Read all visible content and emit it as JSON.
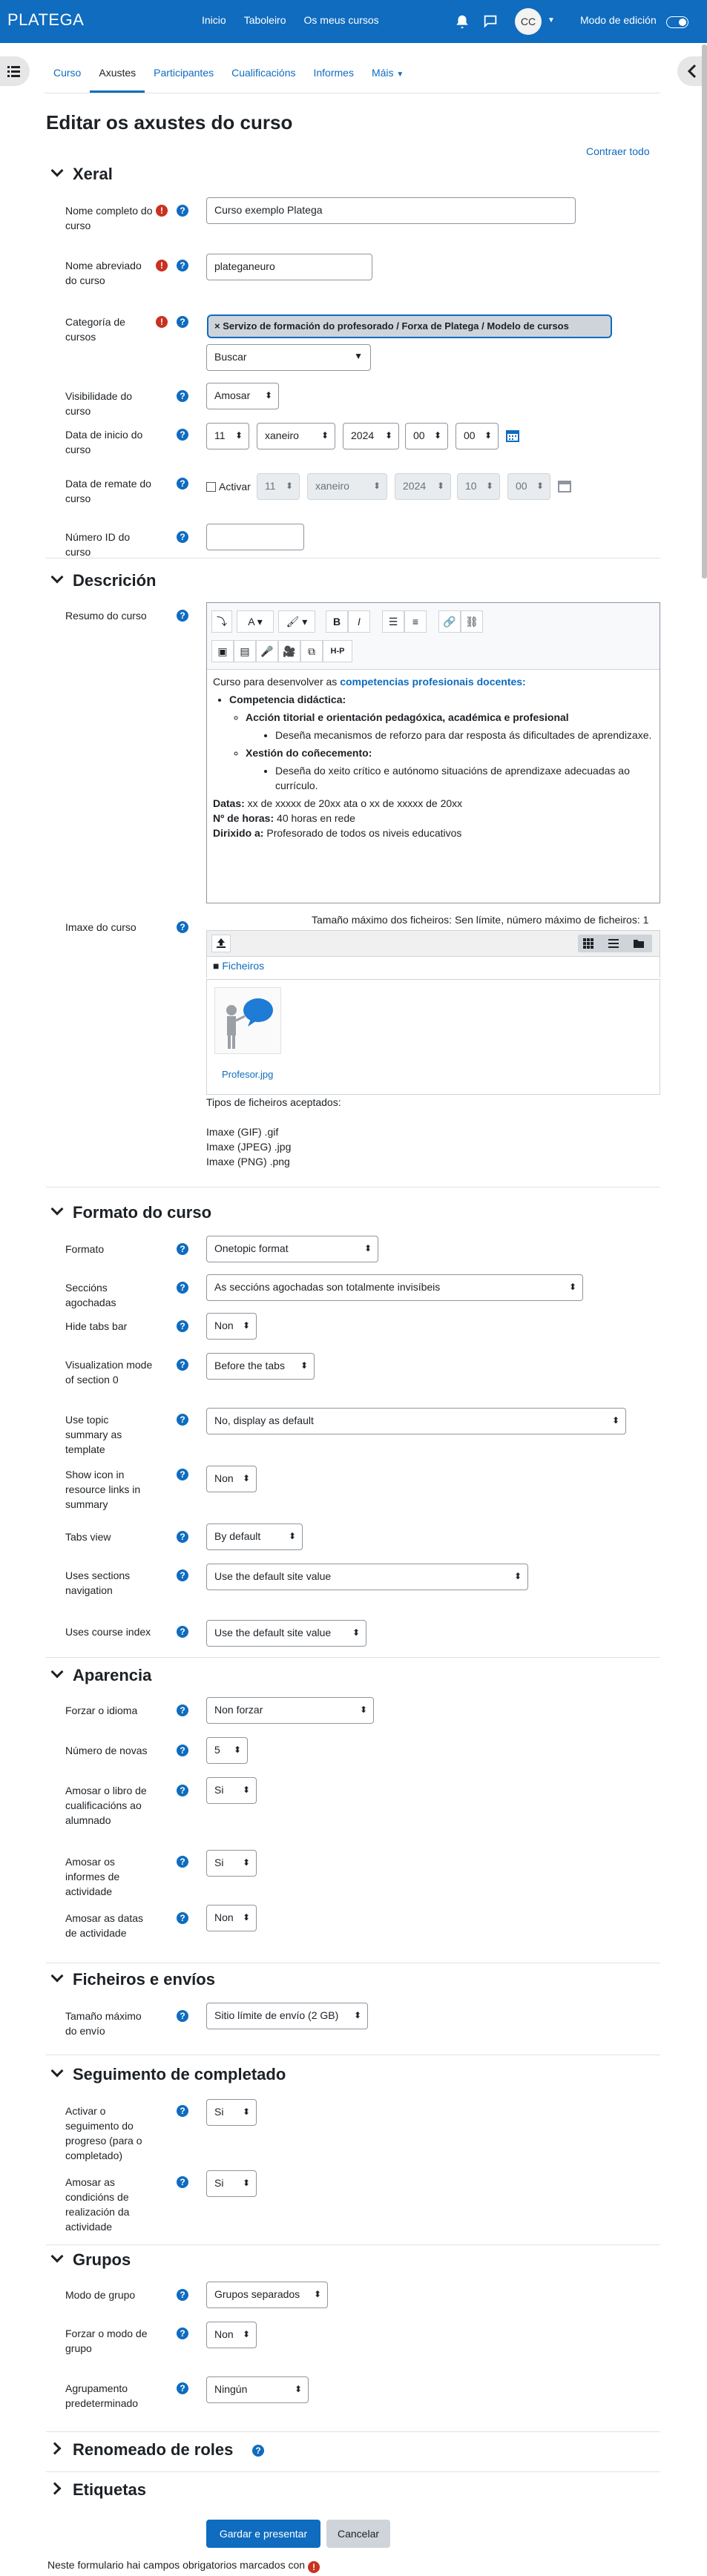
{
  "navbar": {
    "brand": "PLATEGA",
    "links": [
      "Inicio",
      "Taboleiro",
      "Os meus cursos"
    ],
    "avatar_initials": "CC",
    "edit_mode_label": "Modo de edición"
  },
  "secondary_nav": {
    "tabs": [
      "Curso",
      "Axustes",
      "Participantes",
      "Cualificacións",
      "Informes",
      "Máis"
    ],
    "active": "Axustes"
  },
  "page": {
    "title": "Editar os axustes do curso",
    "collapse_all": "Contraer todo"
  },
  "general": {
    "heading": "Xeral",
    "fullname_label": "Nome completo do curso",
    "fullname_value": "Curso exemplo Platega",
    "shortname_label": "Nome abreviado do curso",
    "shortname_value": "plateganeuro",
    "category_label": "Categoría de cursos",
    "category_value": "× Servizo de formación do profesorado / Forxa de Platega / Modelo de cursos",
    "category_search": "Buscar",
    "visibility_label": "Visibilidade do curso",
    "visibility_value": "Amosar",
    "startdate_label": "Data de inicio do curso",
    "startdate": {
      "day": "11",
      "month": "xaneiro",
      "year": "2024",
      "hour": "00",
      "minute": "00"
    },
    "enddate_label": "Data de remate do curso",
    "enddate_enable": "Activar",
    "enddate": {
      "day": "11",
      "month": "xaneiro",
      "year": "2024",
      "hour": "10",
      "minute": "00"
    },
    "idnumber_label": "Número ID do curso",
    "idnumber_value": ""
  },
  "description": {
    "heading": "Descrición",
    "summary_label": "Resumo do curso",
    "toolbar_row1": [
      "⤵",
      "A ▾",
      "🖌 ▾",
      "B",
      "I",
      "☰",
      "≡",
      "🔗",
      "⛓"
    ],
    "toolbar_row2": [
      "▣",
      "▤",
      "🎤",
      "🎥",
      "⧉",
      "H-P"
    ],
    "body_intro": "Curso para desenvolver as ",
    "body_intro_link": "competencias profesionais docentes:",
    "competencia1": "Competencia didáctica:",
    "accion": "Acción titorial e orientación pedagóxica, académica e profesional",
    "accion_item": "Deseña mecanismos de reforzo para dar resposta ás dificultades de aprendizaxe.",
    "xestion": "Xestión do coñecemento:",
    "xestion_item": "Deseña do xeito crítico e autónomo situacións de aprendizaxe adecuadas ao currículo.",
    "datas_label": "Datas:",
    "datas_value": " xx de xxxxx de 20xx ata o xx de xxxxx de 20xx",
    "horas_label": "Nº de horas:",
    "horas_value": " 40 horas en rede",
    "dirixido_label": "Dirixido a:",
    "dirixido_value": " Profesorado de todos os niveis educativos",
    "image_label": "Imaxe do curso",
    "max_size": "Tamaño máximo dos ficheiros: Sen límite, número máximo de ficheiros: 1",
    "files_folder": "Ficheiros",
    "file_name": "Profesor.jpg",
    "accepted_title": "Tipos de ficheiros aceptados:",
    "accepted_gif": "Imaxe (GIF) .gif",
    "accepted_jpeg": "Imaxe (JPEG) .jpg",
    "accepted_png": "Imaxe (PNG) .png"
  },
  "format": {
    "heading": "Formato do curso",
    "format_label": "Formato",
    "format_value": "Onetopic format",
    "hidden_label": "Seccións agochadas",
    "hidden_value": "As seccións agochadas son totalmente invisíbeis",
    "hidetabs_label": "Hide tabs bar",
    "hidetabs_value": "Non",
    "vismode_label": "Visualization mode of section 0",
    "vismode_value": "Before the tabs",
    "topicsum_label": "Use topic summary as template",
    "topicsum_value": "No, display as default",
    "showicon_label": "Show icon in resource links in summary",
    "showicon_value": "Non",
    "tabsview_label": "Tabs view",
    "tabsview_value": "By default",
    "secnav_label": "Uses sections navigation",
    "secnav_value": "Use the default site value",
    "courseindex_label": "Uses course index",
    "courseindex_value": "Use the default site value"
  },
  "appearance": {
    "heading": "Aparencia",
    "lang_label": "Forzar o idioma",
    "lang_value": "Non forzar",
    "news_label": "Número de novas",
    "news_value": "5",
    "grades_label": "Amosar o libro de cualificacións ao alumnado",
    "grades_value": "Si",
    "reports_label": "Amosar os informes de actividade",
    "reports_value": "Si",
    "dates_label": "Amosar as datas de actividade",
    "dates_value": "Non"
  },
  "files": {
    "heading": "Ficheiros e envíos",
    "maxsize_label": "Tamaño máximo do envío",
    "maxsize_value": "Sitio límite de envío (2 GB)"
  },
  "completion": {
    "heading": "Seguimento de completado",
    "enable_label": "Activar o seguimento do progreso (para o completado)",
    "enable_value": "Si",
    "conditions_label": "Amosar as condicións de realización da actividade",
    "conditions_value": "Si"
  },
  "groups": {
    "heading": "Grupos",
    "mode_label": "Modo de grupo",
    "mode_value": "Grupos separados",
    "force_label": "Forzar o modo de grupo",
    "force_value": "Non",
    "grouping_label": "Agrupamento predeterminado",
    "grouping_value": "Ningún"
  },
  "roles": {
    "heading": "Renomeado de roles"
  },
  "tags": {
    "heading": "Etiquetas"
  },
  "actions": {
    "save": "Gardar e presentar",
    "cancel": "Cancelar",
    "required_note": "Neste formulario hai campos obrigatorios marcados con"
  },
  "colors": {
    "primary": "#0f6cbf",
    "required": "#ca3120"
  }
}
